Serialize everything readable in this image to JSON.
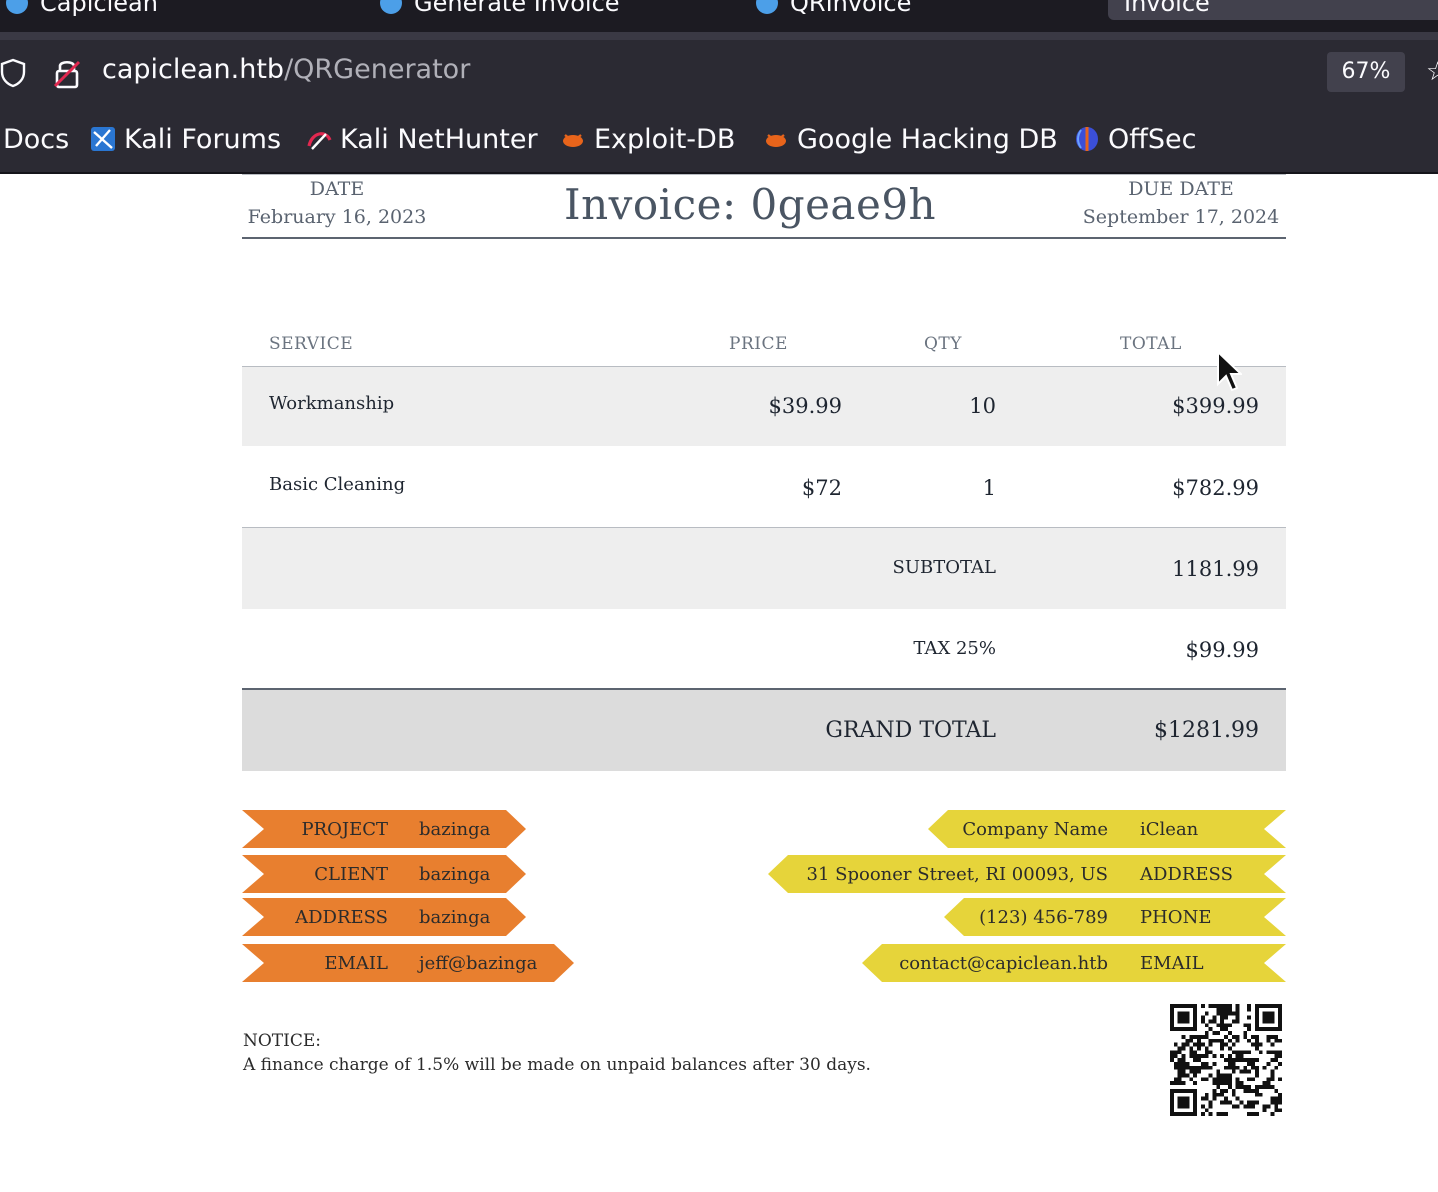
{
  "browser": {
    "tabs": [
      {
        "label": "Capiclean"
      },
      {
        "label": "Generate Invoice"
      },
      {
        "label": "QRInvoice"
      },
      {
        "label": "Invoice"
      }
    ],
    "url_host": "capiclean.htb",
    "url_path": "/QRGenerator",
    "zoom": "67%",
    "bookmarks": [
      {
        "label": "Docs",
        "icon": "docs-icon"
      },
      {
        "label": "Kali Forums",
        "icon": "kali-forums-icon"
      },
      {
        "label": "Kali NetHunter",
        "icon": "kali-nethunter-icon"
      },
      {
        "label": "Exploit-DB",
        "icon": "exploit-db-icon"
      },
      {
        "label": "Google Hacking DB",
        "icon": "ghdb-icon"
      },
      {
        "label": "OffSec",
        "icon": "offsec-icon"
      }
    ]
  },
  "invoice": {
    "date_label": "DATE",
    "date_value": "February 16, 2023",
    "title": "Invoice: 0geae9h",
    "due_label": "DUE DATE",
    "due_value": "September 17, 2024",
    "columns": {
      "service": "SERVICE",
      "price": "PRICE",
      "qty": "QTY",
      "total": "TOTAL"
    },
    "items": [
      {
        "service": "Workmanship",
        "price": "$39.99",
        "qty": "10",
        "total": "$399.99"
      },
      {
        "service": "Basic Cleaning",
        "price": "$72",
        "qty": "1",
        "total": "$782.99"
      }
    ],
    "subtotal_label": "SUBTOTAL",
    "subtotal_value": "1181.99",
    "tax_label": "TAX 25%",
    "tax_value": "$99.99",
    "grand_total_label": "GRAND TOTAL",
    "grand_total_value": "$1281.99",
    "client_tags": [
      {
        "key": "PROJECT",
        "value": "bazinga"
      },
      {
        "key": "CLIENT",
        "value": "bazinga"
      },
      {
        "key": "ADDRESS",
        "value": "bazinga"
      },
      {
        "key": "EMAIL",
        "value": "jeff@bazinga"
      }
    ],
    "company_tags": [
      {
        "key": "Company Name",
        "value": "iClean"
      },
      {
        "key": "ADDRESS",
        "value": "31 Spooner Street, RI 00093, US"
      },
      {
        "key": "PHONE",
        "value": "(123) 456-789"
      },
      {
        "key": "EMAIL",
        "value": "contact@capiclean.htb"
      }
    ],
    "notice_title": "NOTICE:",
    "notice_text": "A finance charge of 1.5% will be made on unpaid balances after 30 days."
  },
  "colors": {
    "client_tag": "#e87f2f",
    "company_tag": "#e6d43a",
    "row_shade": "#eeeeee",
    "grand_total_row": "#dcdcdc"
  }
}
